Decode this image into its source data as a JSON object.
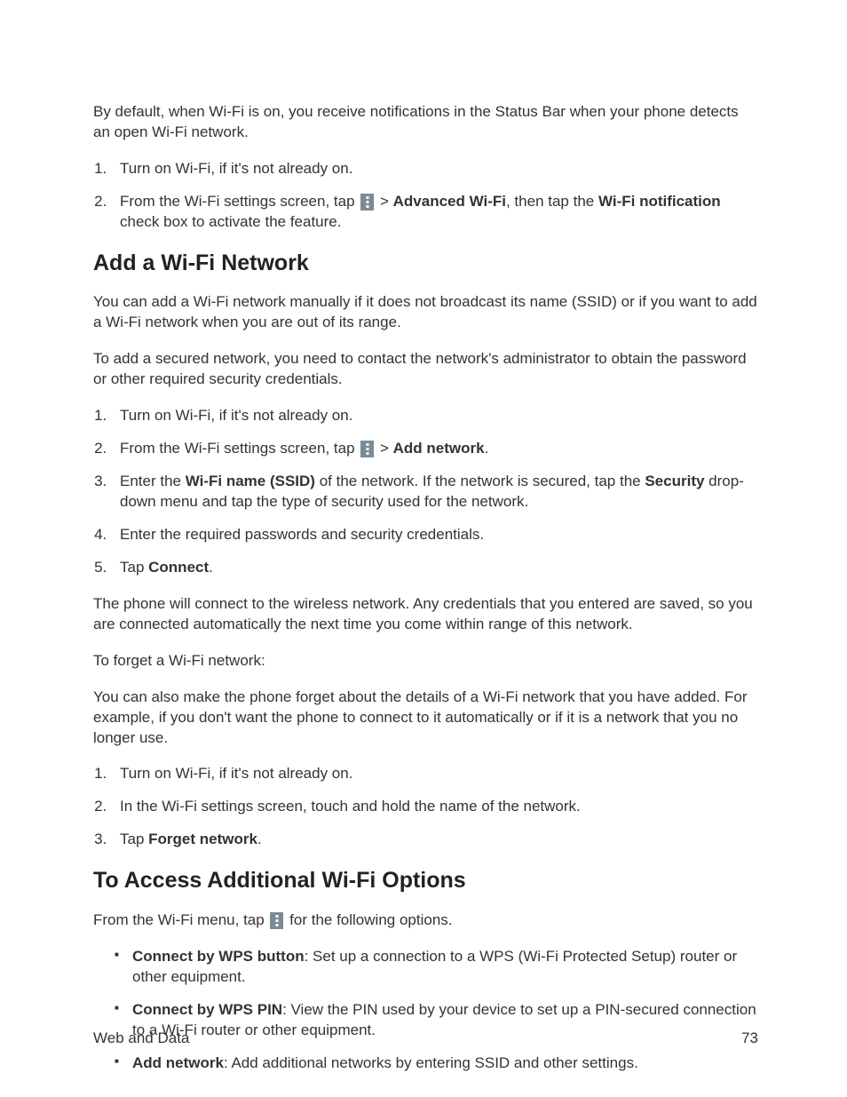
{
  "intro": "By default, when Wi-Fi is on, you receive notifications in the Status Bar when your phone detects an open Wi-Fi network.",
  "list1": {
    "i1": "Turn on Wi-Fi, if it's not already on.",
    "i2a": "From the Wi-Fi settings screen, tap ",
    "i2b": " > ",
    "i2_bold1": "Advanced Wi-Fi",
    "i2c": ", then tap the ",
    "i2_bold2": "Wi-Fi notification",
    "i2d": " check box to activate the feature."
  },
  "h1": "Add a Wi-Fi Network",
  "p2": "You can add a Wi-Fi network manually if it does not broadcast its name (SSID) or if you want to add a Wi-Fi network when you are out of its range.",
  "p3": "To add a secured network, you need to contact the network's administrator to obtain the password or other required security credentials.",
  "list2": {
    "i1": "Turn on Wi-Fi, if it's not already on.",
    "i2a": "From the Wi-Fi settings screen, tap ",
    "i2b": " > ",
    "i2_bold": "Add network",
    "i2c": ".",
    "i3a": "Enter the ",
    "i3_bold1": "Wi-Fi name (SSID)",
    "i3b": " of the network. If the network is secured, tap the ",
    "i3_bold2": "Security",
    "i3c": " drop-down menu and tap the type of security used for the network.",
    "i4": "Enter the required passwords and security credentials.",
    "i5a": "Tap ",
    "i5_bold": "Connect",
    "i5b": "."
  },
  "p4": "The phone will connect to the wireless network. Any credentials that you entered are saved, so you are connected automatically the next time you come within range of this network.",
  "p5": "To forget a Wi-Fi network:",
  "p6": "You can also make the phone forget about the details of a Wi-Fi network that you have added. For example, if you don't want the phone to connect to it automatically or if it is a network that you no longer use.",
  "list3": {
    "i1": "Turn on Wi-Fi, if it's not already on.",
    "i2": "In the Wi-Fi settings screen, touch and hold the name of the network.",
    "i3a": "Tap ",
    "i3_bold": "Forget network",
    "i3b": "."
  },
  "h2": "To Access Additional Wi-Fi Options",
  "p7a": "From the Wi-Fi menu, tap ",
  "p7b": " for the following options.",
  "blist": {
    "i1_bold": "Connect by WPS button",
    "i1": ": Set up a connection to a WPS (Wi-Fi Protected Setup) router or other equipment.",
    "i2_bold": "Connect by WPS PIN",
    "i2": ": View the PIN used by your device to set up a PIN-secured connection to a Wi-Fi router or other equipment.",
    "i3_bold": "Add network",
    "i3": ": Add additional networks by entering SSID and other settings."
  },
  "footer_left": "Web and Data",
  "footer_right": "73"
}
